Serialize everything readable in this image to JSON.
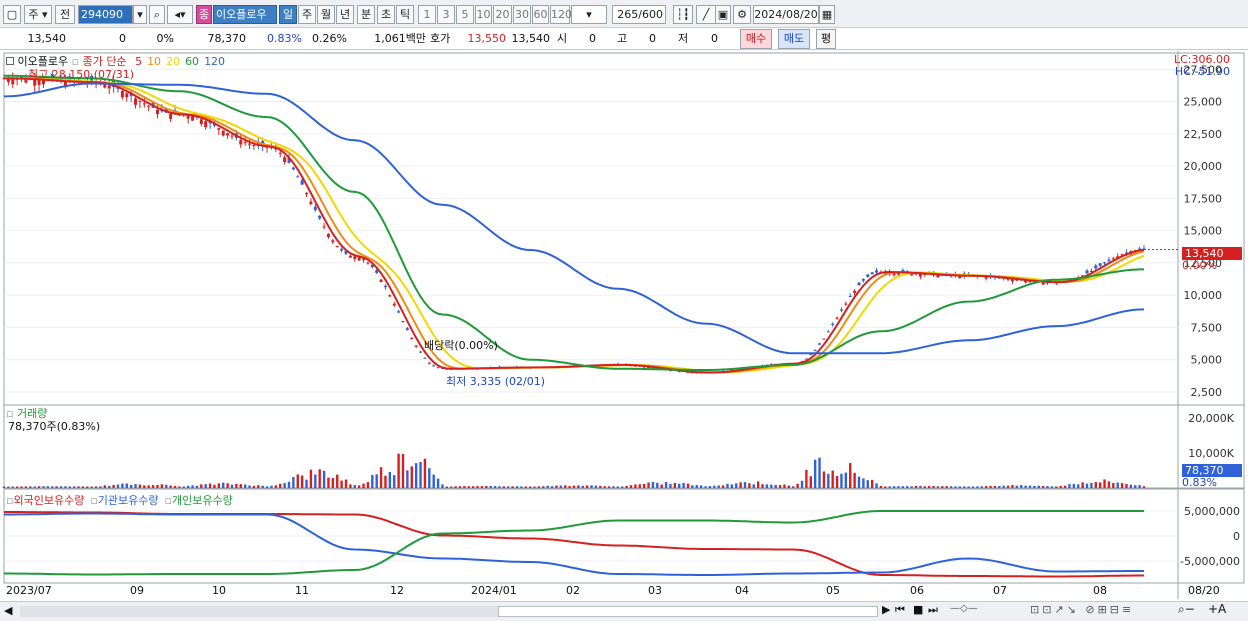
{
  "toolbar": {
    "market": "주",
    "prev": "전",
    "code": "294090",
    "name_badge": "종",
    "name": "이오플로우",
    "periods": [
      "일",
      "주",
      "월",
      "년",
      "분",
      "초",
      "틱"
    ],
    "active_period": "일",
    "intervals": [
      "1",
      "3",
      "5",
      "10",
      "20",
      "30",
      "60",
      "120"
    ],
    "count": "265",
    "count_max": "/600",
    "date": "2024/08/20"
  },
  "infobar": {
    "price": "13,540",
    "change": "0",
    "change_pct": "0%",
    "volume": "78,370",
    "turnover_rate": "0.83%",
    "rate2": "0.26%",
    "amount": "1,061백만",
    "quote_label": "호가",
    "ask": "13,550",
    "bid": "13,540",
    "open_label": "시",
    "open": "0",
    "high_label": "고",
    "high": "0",
    "low_label": "저",
    "low": "0",
    "buy_label": "매수",
    "sell_label": "매도",
    "avg_label": "평"
  },
  "price_panel": {
    "title": "이오플로우",
    "ma_label": "종가 단순",
    "ma_periods": [
      {
        "period": "5",
        "color": "#d62020"
      },
      {
        "period": "10",
        "color": "#f08a10"
      },
      {
        "period": "20",
        "color": "#f2d800"
      },
      {
        "period": "60",
        "color": "#1f9a3a"
      },
      {
        "period": "120",
        "color": "#2f62d8"
      }
    ],
    "high_note": "최고 28,150 (07/31)",
    "low_note": "최저 3,335 (02/01)",
    "dividend_note": "배당락(0.00%)",
    "lc": "LC:306.00",
    "hc": "HC:-51.90",
    "cur_tag": "13,540",
    "cur_pct": "0.00%"
  },
  "volume_panel": {
    "title": "거래량",
    "value": "78,370주(0.83%)",
    "cur_tag": "78,370",
    "cur_pct": "0.83%"
  },
  "holding_panel": {
    "series": [
      {
        "name": "외국인보유수량",
        "color": "#d62020"
      },
      {
        "name": "기관보유수량",
        "color": "#2f62d8"
      },
      {
        "name": "개인보유수량",
        "color": "#1f9a3a"
      }
    ]
  },
  "x_axis": {
    "labels": [
      "2023/07",
      "09",
      "10",
      "11",
      "12",
      "2024/01",
      "02",
      "03",
      "04",
      "05",
      "06",
      "07",
      "08"
    ],
    "right_label": "08/20"
  },
  "chart_data": [
    {
      "type": "line",
      "name": "price",
      "y_ticks": [
        "27,500",
        "25,000",
        "22,500",
        "20,000",
        "17,500",
        "15,000",
        "12,500",
        "10,000",
        "7,500",
        "5,000",
        "2,500"
      ],
      "ylim": [
        1800,
        28300
      ],
      "x": [
        "2023/07",
        "09",
        "10",
        "11",
        "12",
        "2024/01",
        "02",
        "03",
        "04",
        "05",
        "06",
        "07",
        "08",
        "08/20"
      ],
      "close_approx": [
        26800,
        26500,
        24000,
        21500,
        13000,
        4300,
        4400,
        4600,
        4000,
        4700,
        11800,
        11500,
        11000,
        13540
      ],
      "ma60_approx": [
        27000,
        26800,
        25800,
        23800,
        18000,
        8500,
        5000,
        4300,
        4200,
        4600,
        7200,
        9500,
        11200,
        12000
      ],
      "ma120_approx": [
        25400,
        26400,
        26300,
        25600,
        22000,
        17000,
        13500,
        10500,
        7800,
        5500,
        5500,
        6500,
        7600,
        8900
      ]
    },
    {
      "type": "bar",
      "name": "volume",
      "y_ticks": [
        "20,000K",
        "10,000K"
      ],
      "ylim": [
        0,
        22000
      ]
    },
    {
      "type": "line",
      "name": "holdings",
      "y_ticks": [
        "5,000,000",
        "0",
        "-5,000,000"
      ],
      "ylim": [
        -9000000,
        7000000
      ],
      "series": [
        {
          "name": "외국인보유수량",
          "values": [
            4800000,
            4700000,
            4400000,
            4400000,
            4300000,
            100000,
            -500000,
            -1900000,
            -2600000,
            -2700000,
            -7800000,
            -8000000,
            -8100000,
            -7900000
          ]
        },
        {
          "name": "기관보유수량",
          "values": [
            4300000,
            4500000,
            4300000,
            4300000,
            -2700000,
            -4500000,
            -5200000,
            -7600000,
            -7800000,
            -7500000,
            -7300000,
            -4500000,
            -7100000,
            -7000000
          ]
        },
        {
          "name": "개인보유수량",
          "values": [
            -7500000,
            -7700000,
            -7600000,
            -7600000,
            -6800000,
            500000,
            1100000,
            3100000,
            3100000,
            2700000,
            5000000,
            5000000,
            5000000,
            5000000
          ]
        }
      ]
    }
  ]
}
